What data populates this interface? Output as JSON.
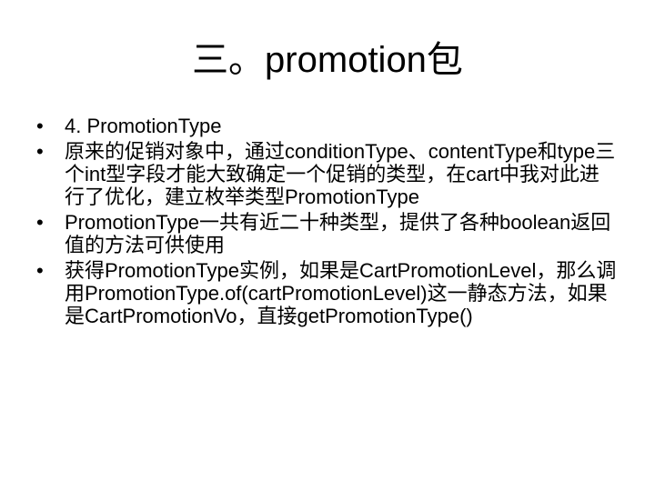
{
  "slide": {
    "title": "三。promotion包",
    "bullet_symbol": "•",
    "bullets": [
      {
        "text": "4. PromotionType"
      },
      {
        "text": "原来的促销对象中，通过conditionType、contentType和type三个int型字段才能大致确定一个促销的类型，在cart中我对此进行了优化，建立枚举类型PromotionType"
      },
      {
        "text": "PromotionType一共有近二十种类型，提供了各种boolean返回值的方法可供使用"
      },
      {
        "text": "获得PromotionType实例，如果是CartPromotionLevel，那么调用PromotionType.of(cartPromotionLevel)这一静态方法，如果是CartPromotionVo，直接getPromotionType()"
      }
    ]
  }
}
